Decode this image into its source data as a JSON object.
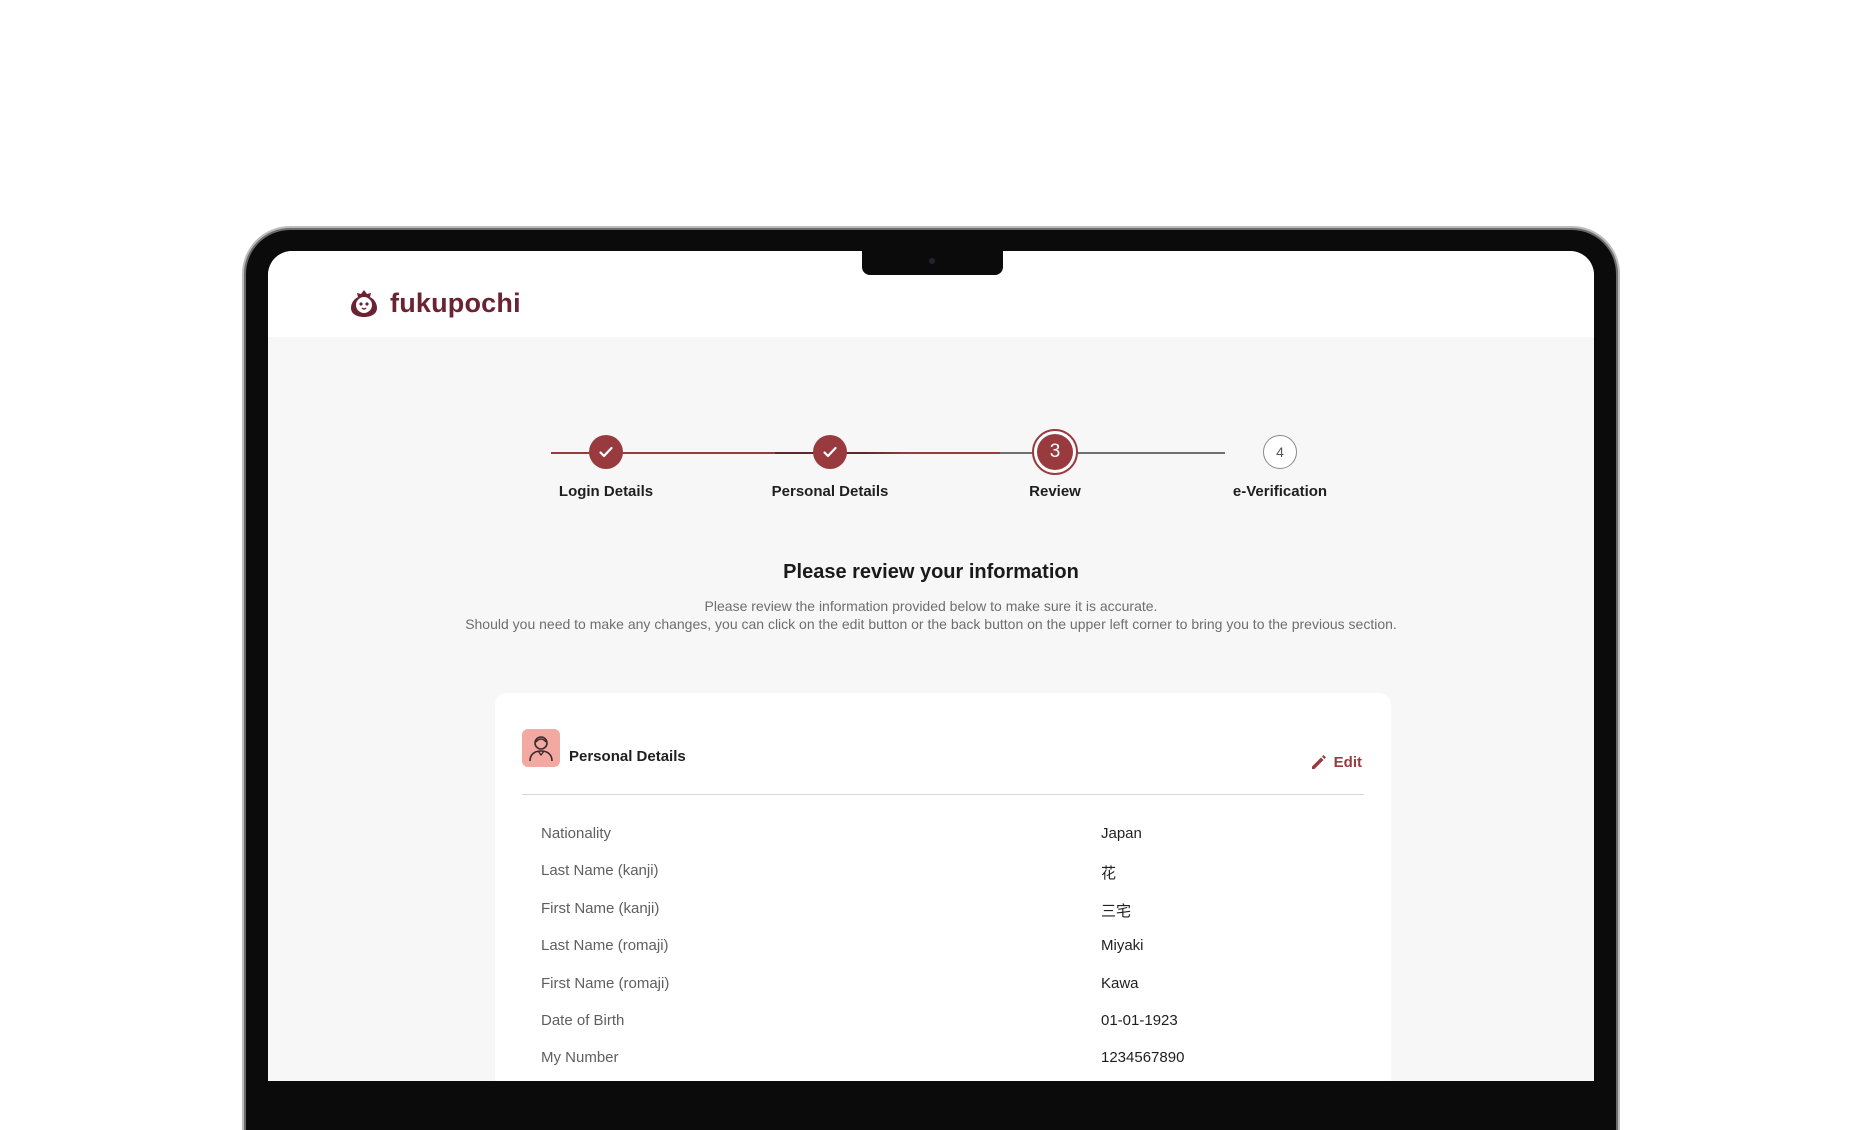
{
  "brand": {
    "name": "fukupochi",
    "color": "#6b2233"
  },
  "accent_color": "#993b3e",
  "stepper": {
    "steps": [
      {
        "label": "Login Details",
        "status": "completed",
        "number": "1"
      },
      {
        "label": "Personal Details",
        "status": "completed",
        "number": "2"
      },
      {
        "label": "Review",
        "status": "current",
        "number": "3"
      },
      {
        "label": "e-Verification",
        "status": "upcoming",
        "number": "4"
      }
    ]
  },
  "review": {
    "title": "Please review your information",
    "line1": "Please review the information provided below to make sure it is accurate.",
    "line2": "Should you need to make any changes, you can click on the edit button or the back button on the upper left corner to bring you to the previous section."
  },
  "personal_details": {
    "title": "Personal Details",
    "edit_label": "Edit",
    "rows": [
      {
        "label": "Nationality",
        "value": "Japan"
      },
      {
        "label": "Last Name (kanji)",
        "value": "花"
      },
      {
        "label": "First Name (kanji)",
        "value": "三宅"
      },
      {
        "label": "Last Name (romaji)",
        "value": "Miyaki"
      },
      {
        "label": "First Name (romaji)",
        "value": "Kawa"
      },
      {
        "label": "Date of Birth",
        "value": "01-01-1923"
      },
      {
        "label": "My Number",
        "value": "1234567890"
      }
    ]
  }
}
